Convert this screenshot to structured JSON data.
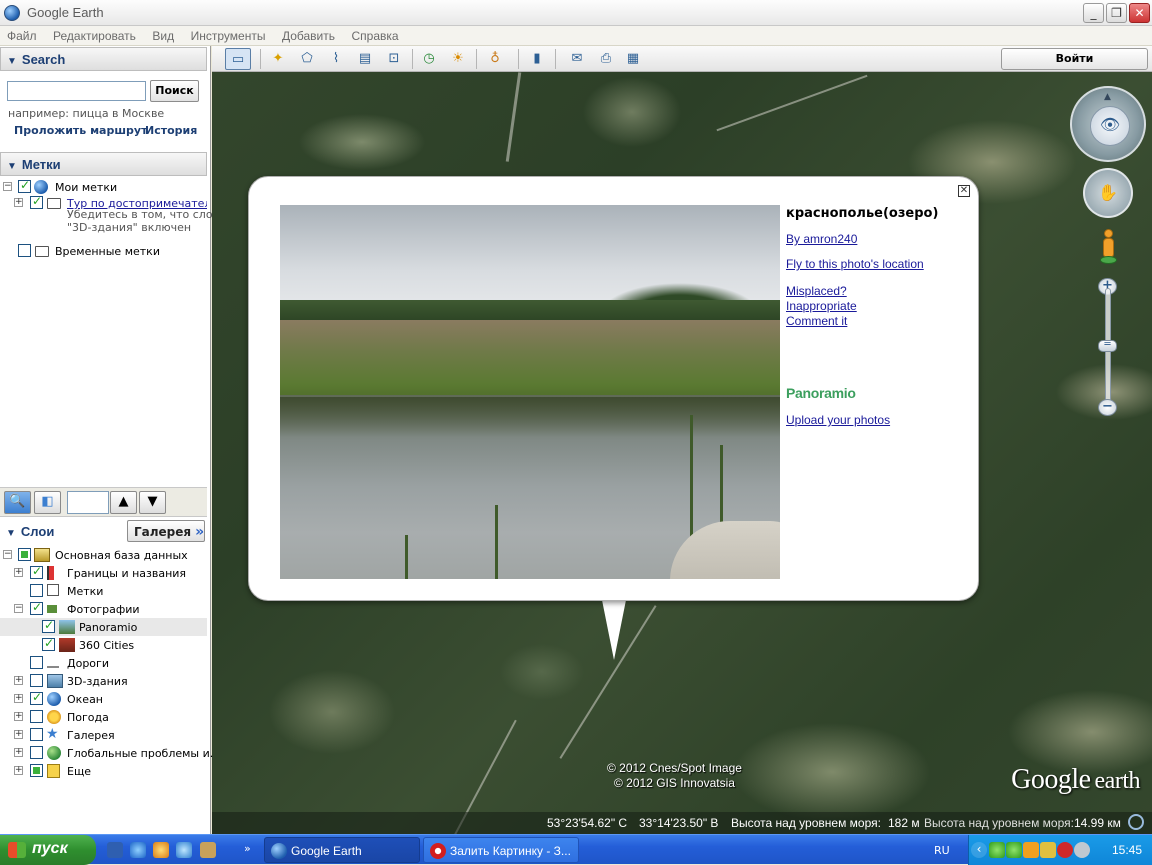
{
  "window": {
    "title": "Google Earth",
    "minimize": "_",
    "maximize": "❐",
    "close": "✕"
  },
  "menu": [
    "Файл",
    "Редактировать",
    "Вид",
    "Инструменты",
    "Добавить",
    "Справка"
  ],
  "search": {
    "header": "Search",
    "value": "",
    "button": "Поиск",
    "hint": "например: пицца в Москве",
    "route_link": "Проложить маршрут",
    "history_link": "История"
  },
  "places": {
    "header": "Метки",
    "items": [
      {
        "label": "Мои метки"
      },
      {
        "label": "Тур по достопримечательностям",
        "note1": "Убедитесь в том, что слой",
        "note2": "\"3D-здания\" включен"
      },
      {
        "label": "Временные метки"
      }
    ]
  },
  "layers": {
    "header": "Слои",
    "gallery_button": "Галерея",
    "items": [
      {
        "label": "Основная база данных"
      },
      {
        "label": "Границы и названия"
      },
      {
        "label": "Метки"
      },
      {
        "label": "Фотографии"
      },
      {
        "label": "Panoramio"
      },
      {
        "label": "360 Cities"
      },
      {
        "label": "Дороги"
      },
      {
        "label": "3D-здания"
      },
      {
        "label": "Океан"
      },
      {
        "label": "Погода"
      },
      {
        "label": "Галерея"
      },
      {
        "label": "Глобальные проблемы и..."
      },
      {
        "label": "Еще"
      }
    ]
  },
  "toolbar": {
    "login": "Войти"
  },
  "balloon": {
    "title": "краснополье(озеро)",
    "author": "By amron240",
    "fly_to": "Fly to this photo's location",
    "misplaced": "Misplaced?",
    "inappropriate": "Inappropriate",
    "comment": "Comment it",
    "logo": "Panoramio",
    "upload": "Upload your photos",
    "close": "✕"
  },
  "map": {
    "credit1": "© 2012 Cnes/Spot Image",
    "credit2": "© 2012 GIS Innovatsia",
    "logo_google": "Google",
    "logo_earth": "earth",
    "lat": "53°23'54.62\" С",
    "lon": "33°14'23.50\" В",
    "elev_label": "Высота над уровнем моря:",
    "elev_value": "182 м",
    "eye_label": "Высота над уровнем моря:",
    "eye_value": "14.99 км"
  },
  "taskbar": {
    "start": "пуск",
    "tasks": [
      "Google Earth",
      "Залить Картинку - З..."
    ],
    "lang": "RU",
    "clock": "15:45"
  }
}
